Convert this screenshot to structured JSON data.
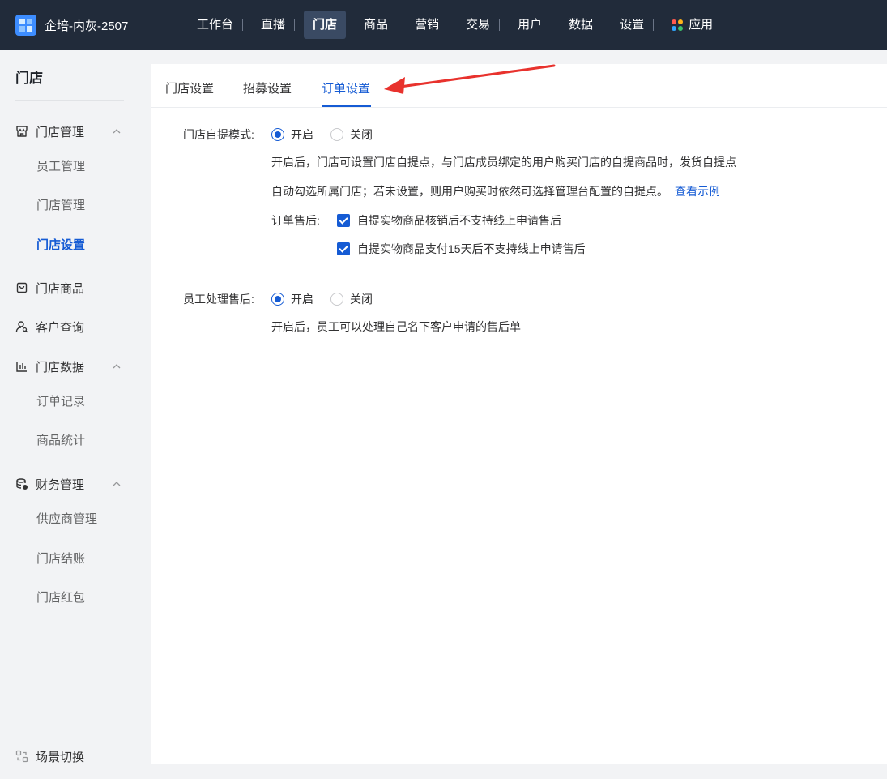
{
  "brand": {
    "name": "企培-内灰-2507"
  },
  "topnav": [
    {
      "label": "工作台",
      "active": false
    },
    {
      "label": "直播",
      "active": false
    },
    {
      "label": "门店",
      "active": true
    },
    {
      "label": "商品",
      "active": false
    },
    {
      "label": "营销",
      "active": false
    },
    {
      "label": "交易",
      "active": false
    },
    {
      "label": "用户",
      "active": false
    },
    {
      "label": "数据",
      "active": false
    },
    {
      "label": "设置",
      "active": false
    },
    {
      "label": "应用",
      "active": false
    }
  ],
  "sidebar": {
    "title": "门店",
    "groups": [
      {
        "label": "门店管理",
        "icon": "store-icon",
        "items": [
          "员工管理",
          "门店管理",
          "门店设置"
        ]
      },
      {
        "label": "门店商品",
        "icon": "bag-icon",
        "items": []
      },
      {
        "label": "客户查询",
        "icon": "user-search-icon",
        "items": []
      },
      {
        "label": "门店数据",
        "icon": "chart-icon",
        "items": [
          "订单记录",
          "商品统计"
        ]
      },
      {
        "label": "财务管理",
        "icon": "finance-icon",
        "items": [
          "供应商管理",
          "门店结账",
          "门店红包"
        ]
      }
    ],
    "active_item": "门店设置",
    "bottom": {
      "label": "场景切换",
      "icon": "switch-icon"
    }
  },
  "tabs": [
    "门店设置",
    "招募设置",
    "订单设置"
  ],
  "active_tab": "订单设置",
  "self_pickup": {
    "label": "门店自提模式:",
    "on_label": "开启",
    "off_label": "关闭",
    "selected": "开启",
    "desc_line1": "开启后，门店可设置门店自提点，与门店成员绑定的用户购买门店的自提商品时，发货自提点",
    "desc_line2": "自动勾选所属门店；若未设置，则用户购买时依然可选择管理台配置的自提点。",
    "example_link": "查看示例",
    "after_sale_label": "订单售后:",
    "checkbox1": "自提实物商品核销后不支持线上申请售后",
    "checkbox2": "自提实物商品支付15天后不支持线上申请售后"
  },
  "staff_after_sale": {
    "label": "员工处理售后:",
    "on_label": "开启",
    "off_label": "关闭",
    "selected": "开启",
    "desc": "开启后，员工可以处理自己名下客户申请的售后单"
  },
  "colors": {
    "topbar": "#212b3a",
    "accent": "#155bd4",
    "annotation_arrow": "#e8322d"
  }
}
